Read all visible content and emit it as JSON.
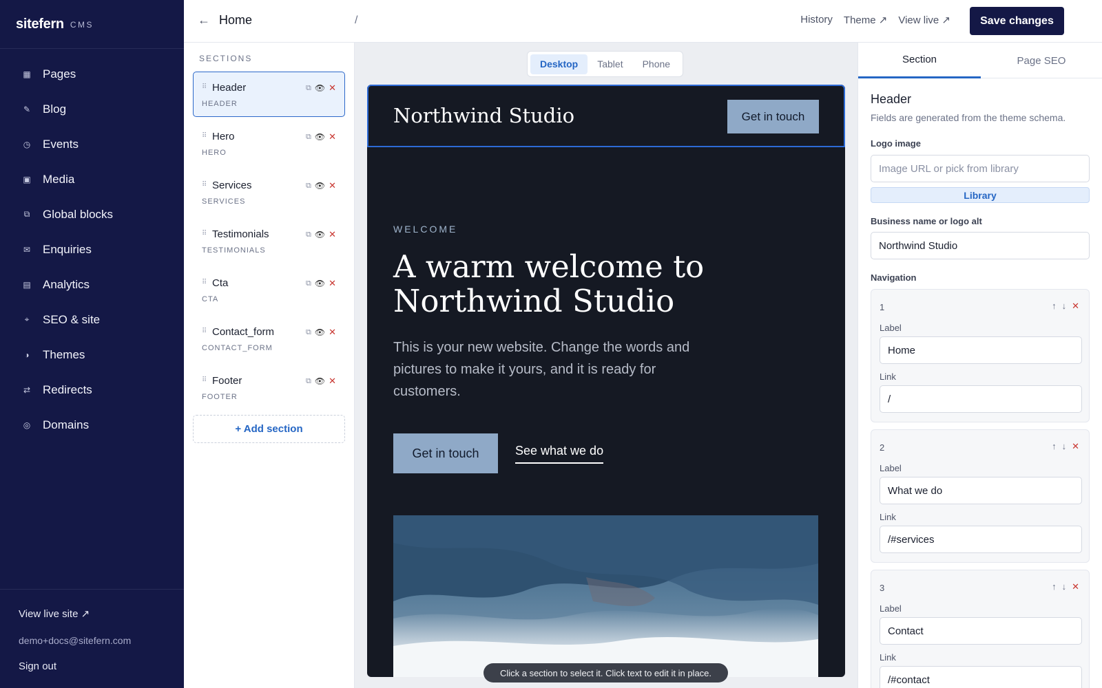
{
  "sidebar": {
    "brand": "sitefern",
    "brand_sub": "CMS",
    "items": [
      {
        "label": "Pages",
        "icon": "▦"
      },
      {
        "label": "Blog",
        "icon": "✎"
      },
      {
        "label": "Events",
        "icon": "◷"
      },
      {
        "label": "Media",
        "icon": "▣"
      },
      {
        "label": "Global blocks",
        "icon": "⧉"
      },
      {
        "label": "Enquiries",
        "icon": "✉"
      },
      {
        "label": "Analytics",
        "icon": "▤"
      },
      {
        "label": "SEO & site",
        "icon": "⌖"
      },
      {
        "label": "Themes",
        "icon": "◑"
      },
      {
        "label": "Redirects",
        "icon": "⇄"
      },
      {
        "label": "Domains",
        "icon": "◎"
      }
    ],
    "view_live": "View live site ↗",
    "email": "demo+docs@sitefern.com",
    "sign_out": "Sign out"
  },
  "topbar": {
    "back": "←",
    "page_title": "Home",
    "slug": "/",
    "history": "History",
    "theme": "Theme ↗",
    "view_live": "View live ↗",
    "save": "Save changes"
  },
  "sections_panel": {
    "title": "SECTIONS",
    "items": [
      {
        "name": "Header",
        "type": "HEADER",
        "active": true
      },
      {
        "name": "Hero",
        "type": "HERO"
      },
      {
        "name": "Services",
        "type": "SERVICES"
      },
      {
        "name": "Testimonials",
        "type": "TESTIMONIALS"
      },
      {
        "name": "Cta",
        "type": "CTA"
      },
      {
        "name": "Contact_form",
        "type": "CONTACT_FORM"
      },
      {
        "name": "Footer",
        "type": "FOOTER"
      }
    ],
    "icons": {
      "grip": "⠿",
      "duplicate": "⧉",
      "eye": "👁",
      "delete": "✕"
    },
    "add": "+ Add section"
  },
  "canvas": {
    "devices": [
      "Desktop",
      "Tablet",
      "Phone"
    ],
    "active_device": "Desktop",
    "preview": {
      "logo": "Northwind Studio",
      "header_cta": "Get in touch",
      "eyebrow": "WELCOME",
      "headline": "A warm welcome to Northwind Studio",
      "subtext": "This is your new website. Change the words and pictures to make it yours, and it is ready for customers.",
      "primary_button": "Get in touch",
      "secondary_link": "See what we do"
    },
    "hint": "Click a section to select it. Click text to edit it in place."
  },
  "inspector": {
    "tabs": [
      "Section",
      "Page SEO"
    ],
    "active_tab": "Section",
    "title": "Header",
    "description": "Fields are generated from the theme schema.",
    "logo_image_label": "Logo image",
    "logo_image_placeholder": "Image URL or pick from library",
    "library_button": "Library",
    "business_name_label": "Business name or logo alt",
    "business_name_value": "Northwind Studio",
    "navigation_label": "Navigation",
    "nav_item_label_caption": "Label",
    "nav_item_link_caption": "Link",
    "nav_items": [
      {
        "index": "1",
        "label": "Home",
        "link": "/"
      },
      {
        "index": "2",
        "label": "What we do",
        "link": "/#services"
      },
      {
        "index": "3",
        "label": "Contact",
        "link": "/#contact"
      }
    ],
    "row_icons": {
      "up": "↑",
      "down": "↓",
      "remove": "✕"
    }
  },
  "colors": {
    "sidebar_bg": "#141846",
    "accent": "#2566c4",
    "preview_bg": "#151923",
    "preview_button": "#8fa9c7",
    "danger": "#c8352f"
  }
}
